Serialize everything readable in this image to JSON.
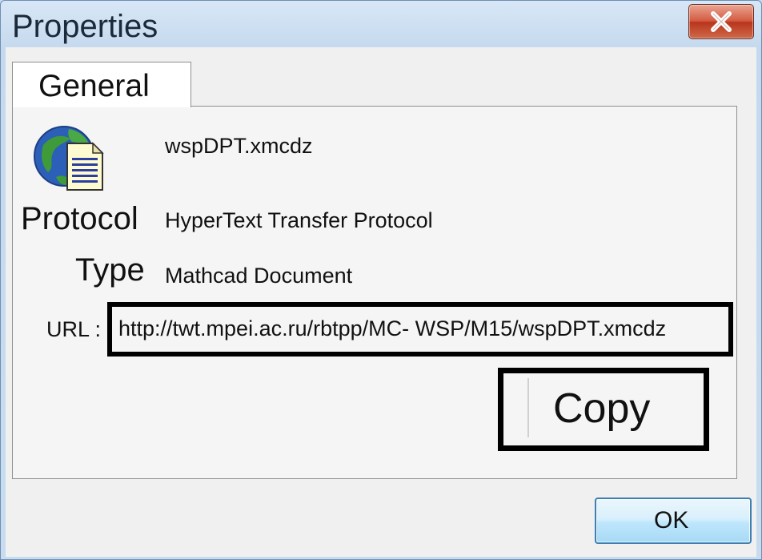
{
  "window": {
    "title": "Properties",
    "close_icon": "close-icon"
  },
  "tabs": [
    {
      "label": "General",
      "selected": true
    }
  ],
  "general": {
    "file_icon": "globe-document-icon",
    "filename": "wspDPT.xmcdz",
    "protocol_label": "Protocol",
    "protocol_value": "HyperText Transfer Protocol",
    "type_label": "Type",
    "type_value": "Mathcad Document",
    "url_label": "URL :",
    "url_value": "http://twt.mpei.ac.ru/rbtpp/MC- WSP/M15/wspDPT.xmcdz",
    "copy_label": "Copy"
  },
  "buttons": {
    "ok_label": "OK"
  },
  "colors": {
    "title_bar": "#c5d9ee",
    "close_button": "#d35a40",
    "ok_button_border": "#3c7fb1",
    "highlight_outline": "#000000"
  }
}
